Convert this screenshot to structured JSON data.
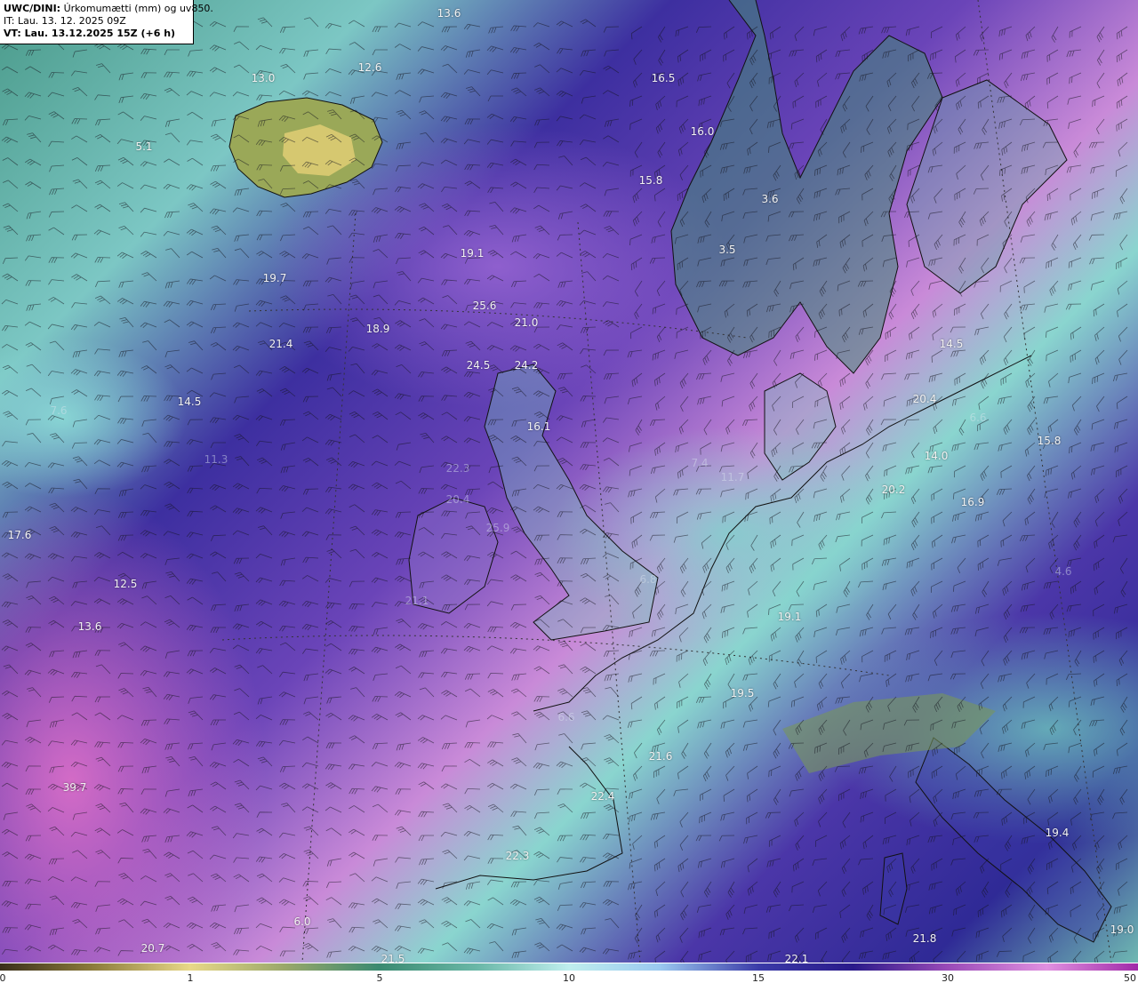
{
  "info": {
    "model": "UWC/DINI:",
    "field": " Úrkomumætti (mm) og uv850.",
    "it": "IT: Lau. 13. 12. 2025 09Z",
    "vt_label": "VT:",
    "vt": " Lau. 13.12.2025 15Z (+6 h)"
  },
  "colors": {
    "low_brown": "#8a7a3a",
    "yellow": "#e8d888",
    "teal": "#3a8a70",
    "light_cyan": "#bfeeee",
    "deep_blue": "#2a1a8a",
    "violet": "#9a4ab8",
    "magenta": "#e090e0"
  },
  "map_labels": [
    {
      "text": "13.6"
    },
    {
      "text": "13.0"
    },
    {
      "text": "12.6"
    },
    {
      "text": "5.1"
    },
    {
      "text": "16.5"
    },
    {
      "text": "16.0"
    },
    {
      "text": "15.8"
    },
    {
      "text": "3.6"
    },
    {
      "text": "3.5"
    },
    {
      "text": "19.7"
    },
    {
      "text": "19.1"
    },
    {
      "text": "25.6"
    },
    {
      "text": "21.0"
    },
    {
      "text": "21.4"
    },
    {
      "text": "18.9"
    },
    {
      "text": "24.5"
    },
    {
      "text": "24.2"
    },
    {
      "text": "14.5"
    },
    {
      "text": "16.1"
    },
    {
      "text": "14.5"
    },
    {
      "text": "20.4"
    },
    {
      "text": "15.8"
    },
    {
      "text": "14.0"
    },
    {
      "text": "20.2"
    },
    {
      "text": "16.9"
    },
    {
      "text": "17.6"
    },
    {
      "text": "12.5"
    },
    {
      "text": "13.6"
    },
    {
      "text": "19.1"
    },
    {
      "text": "19.5"
    },
    {
      "text": "21.6"
    },
    {
      "text": "22.4"
    },
    {
      "text": "22.3"
    },
    {
      "text": "19.4"
    },
    {
      "text": "39.7"
    },
    {
      "text": "6.0"
    },
    {
      "text": "20.7"
    },
    {
      "text": "21.5"
    },
    {
      "text": "22.1"
    },
    {
      "text": "21.8"
    },
    {
      "text": "19.0"
    },
    {
      "text": "6.8"
    },
    {
      "text": "6.6"
    },
    {
      "text": "7.4"
    },
    {
      "text": "21.1"
    },
    {
      "text": "25.9"
    },
    {
      "text": "20.4"
    },
    {
      "text": "22.3"
    },
    {
      "text": "7.6"
    },
    {
      "text": "11.3"
    },
    {
      "text": "4.6"
    },
    {
      "text": "6.6"
    },
    {
      "text": "11.7"
    }
  ],
  "colorbar": {
    "ticks": [
      "0",
      "1",
      "5",
      "10",
      "15",
      "30",
      "50"
    ]
  }
}
